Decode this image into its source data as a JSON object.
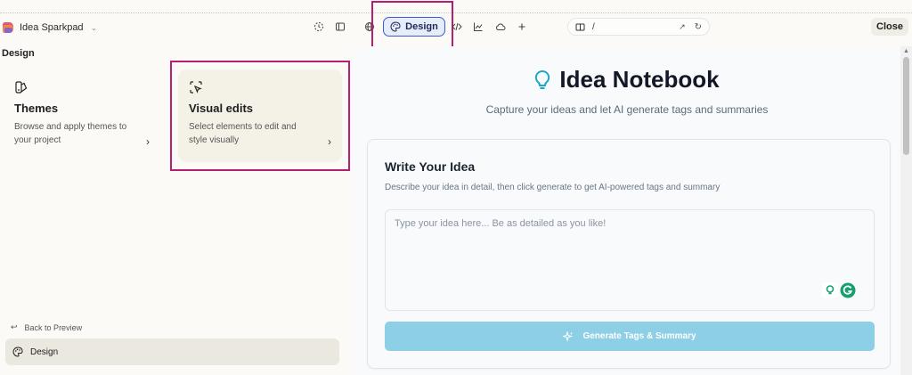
{
  "topbar": {
    "project_name": "Idea Sparkpad",
    "design_label": "Design",
    "url_path": "/",
    "close_label": "Close"
  },
  "left_panel": {
    "title": "Design",
    "cards": [
      {
        "title": "Themes",
        "description": "Browse and apply themes to your project",
        "icon": "themes-icon"
      },
      {
        "title": "Visual edits",
        "description": "Select elements to edit and style visually",
        "icon": "visual-edit-icon"
      }
    ],
    "back_label": "Back to Preview",
    "nav_design_label": "Design"
  },
  "preview": {
    "title": "Idea Notebook",
    "subtitle": "Capture your ideas and let AI generate tags and summaries",
    "card_title": "Write Your Idea",
    "card_subtitle": "Describe your idea in detail, then click generate to get AI-powered tags and summary",
    "textarea_placeholder": "Type your idea here... Be as detailed as you like!",
    "textarea_value": "",
    "generate_label": "Generate Tags & Summary"
  },
  "colors": {
    "accent_highlight": "#b51f72",
    "design_button_border": "#3a5bd9",
    "generate_button": "#8dd0e6",
    "bulb": "#1aa7c9"
  }
}
